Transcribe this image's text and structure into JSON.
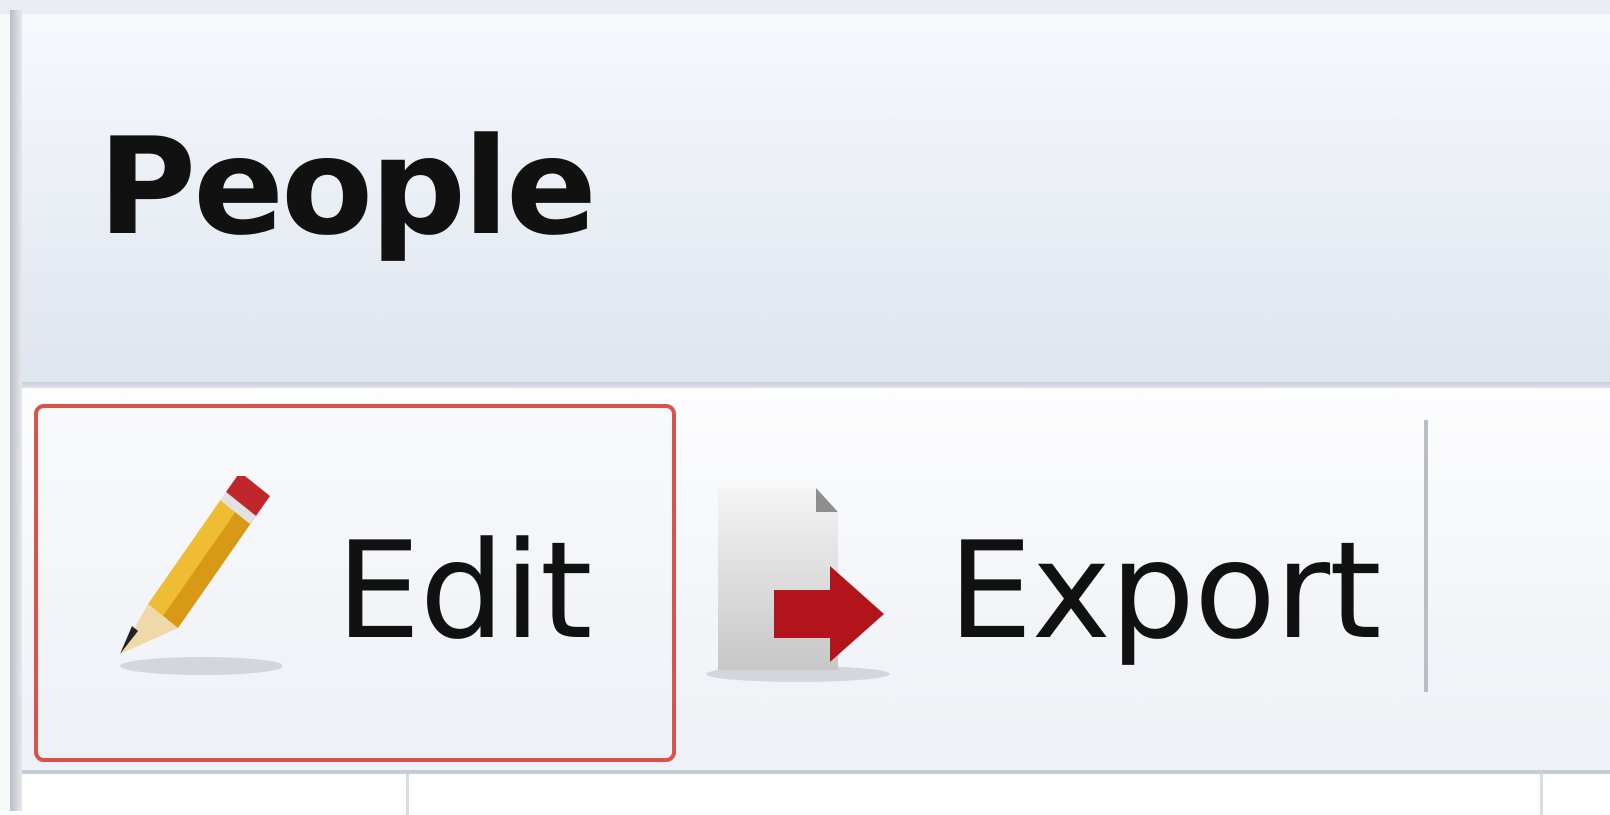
{
  "header": {
    "title": "People"
  },
  "toolbar": {
    "edit_label": "Edit",
    "export_label": "Export",
    "edit_icon": "pencil-icon",
    "export_icon": "export-icon"
  },
  "colors": {
    "selection_border": "#d9534a",
    "header_background": "#e6ebf3",
    "text": "#111111"
  }
}
